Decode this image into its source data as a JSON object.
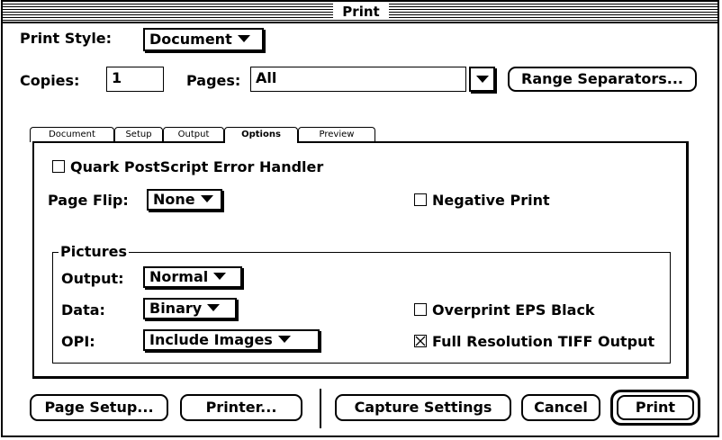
{
  "window": {
    "title": "Print"
  },
  "print_style": {
    "label": "Print Style:",
    "value": "Document"
  },
  "copies": {
    "label": "Copies:",
    "value": "1"
  },
  "pages": {
    "label": "Pages:",
    "value": "All"
  },
  "range_separators_label": "Range Separators...",
  "tabs": [
    {
      "label": "Document",
      "active": false
    },
    {
      "label": "Setup",
      "active": false
    },
    {
      "label": "Output",
      "active": false
    },
    {
      "label": "Options",
      "active": true
    },
    {
      "label": "Preview",
      "active": false
    }
  ],
  "options": {
    "error_handler": {
      "label": "Quark PostScript Error Handler",
      "checked": false
    },
    "page_flip": {
      "label": "Page Flip:",
      "value": "None"
    },
    "negative_print": {
      "label": "Negative Print",
      "checked": false
    }
  },
  "pictures": {
    "title": "Pictures",
    "output": {
      "label": "Output:",
      "value": "Normal"
    },
    "data": {
      "label": "Data:",
      "value": "Binary"
    },
    "opi": {
      "label": "OPI:",
      "value": "Include Images"
    },
    "overprint_eps": {
      "label": "Overprint EPS Black",
      "checked": false
    },
    "full_res_tiff": {
      "label": "Full Resolution TIFF Output",
      "checked": true
    }
  },
  "buttons": {
    "page_setup": "Page Setup...",
    "printer": "Printer...",
    "capture_settings": "Capture Settings",
    "cancel": "Cancel",
    "print": "Print"
  }
}
